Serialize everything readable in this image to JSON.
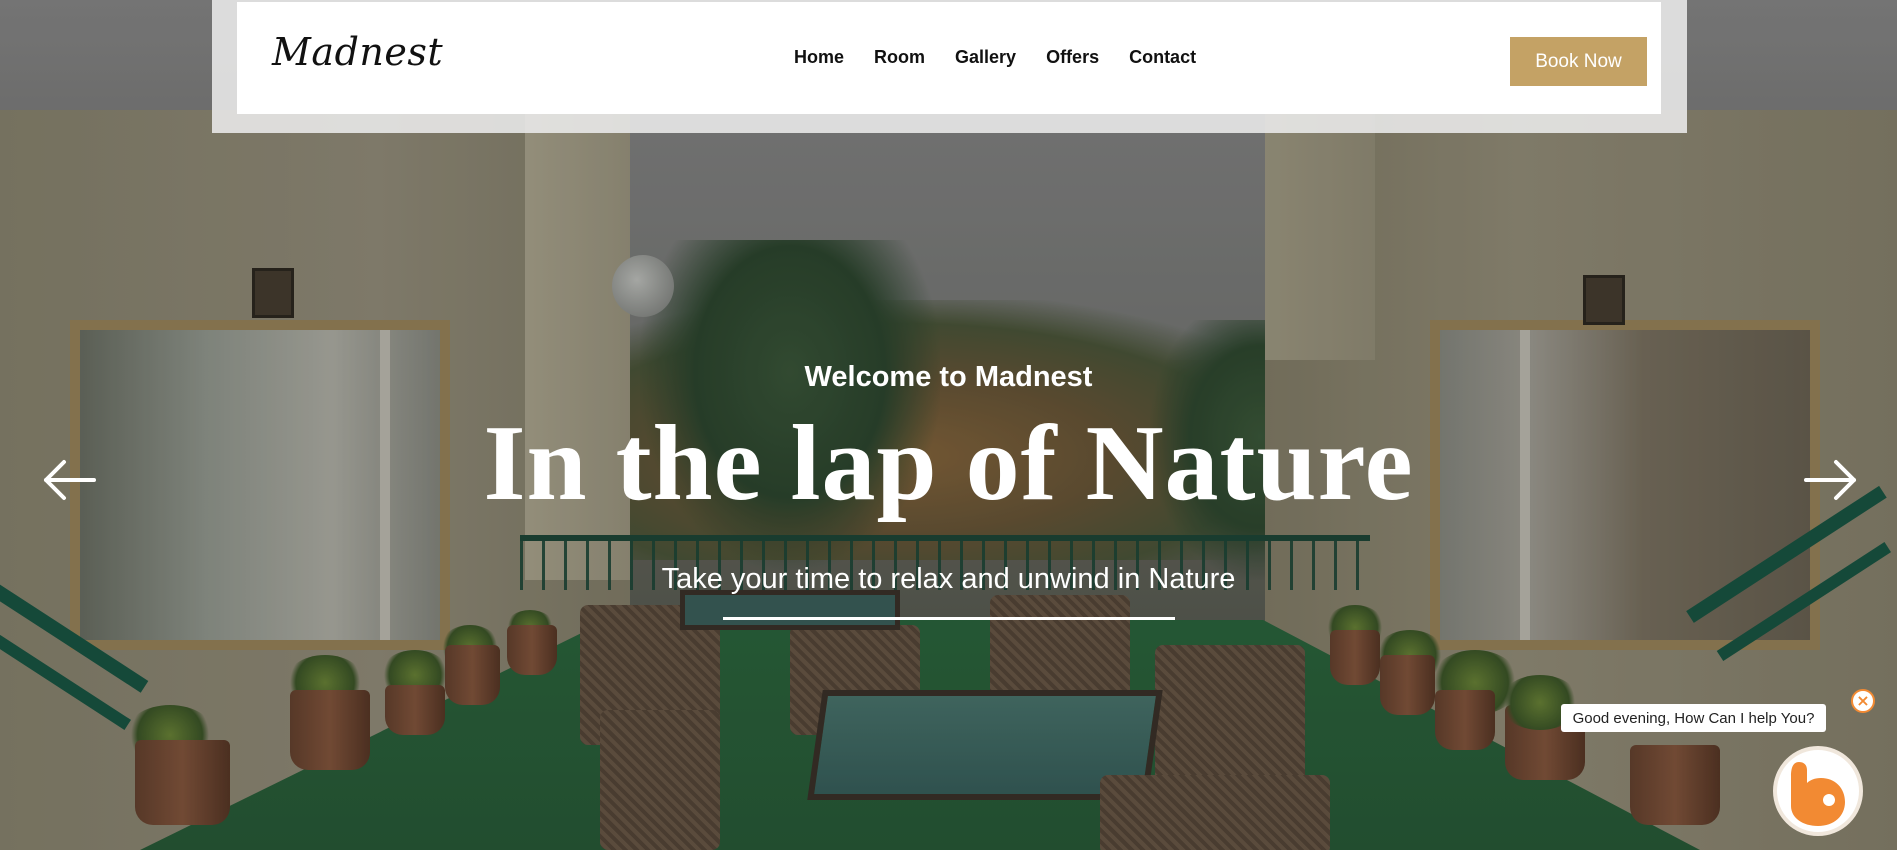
{
  "brand": {
    "logo": "Madnest"
  },
  "nav": {
    "items": [
      {
        "label": "Home"
      },
      {
        "label": "Room"
      },
      {
        "label": "Gallery"
      },
      {
        "label": "Offers"
      },
      {
        "label": "Contact"
      }
    ],
    "cta_label": "Book Now"
  },
  "hero": {
    "kicker": "Welcome to Madnest",
    "headline": "In the lap of Nature",
    "subtitle": "Take your time to relax and unwind in Nature",
    "prev_icon": "arrow-left-icon",
    "next_icon": "arrow-right-icon"
  },
  "chat": {
    "greeting": "Good evening, How Can I help You?",
    "close_icon": "close-icon",
    "launcher_icon": "chat-bot-icon"
  },
  "colors": {
    "accent": "#c4a265",
    "chat_accent": "#f28a33"
  }
}
